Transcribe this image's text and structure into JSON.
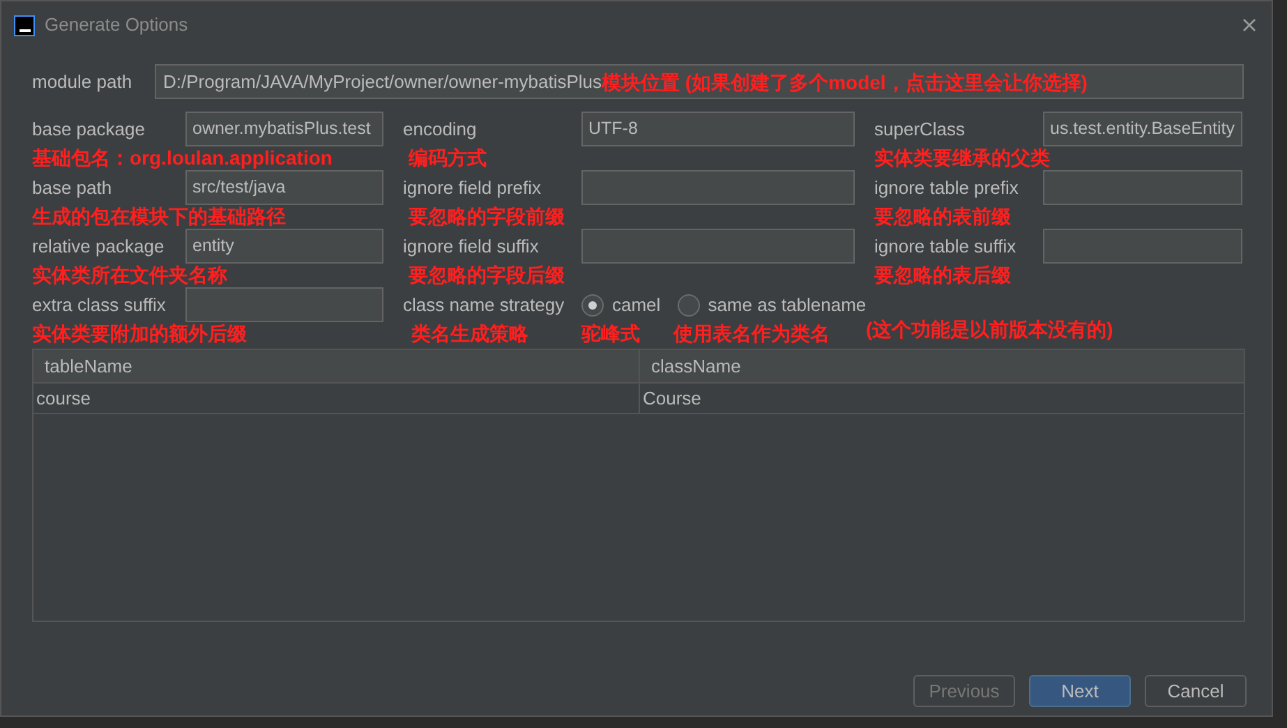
{
  "window": {
    "title": "Generate Options"
  },
  "module_path": {
    "label": "module path",
    "value": "D:/Program/JAVA/MyProject/owner/owner-mybatisPlus",
    "annotation": "模块位置 (如果创建了多个model，点击这里会让你选择)"
  },
  "rows": [
    [
      {
        "kind": "field",
        "label": "base package",
        "value": "owner.mybatisPlus.test",
        "annotation": "基础包名：org.loulan.application"
      },
      {
        "kind": "field",
        "label": "encoding",
        "value": "UTF-8",
        "annotation": "编码方式"
      },
      {
        "kind": "field",
        "label": "superClass",
        "value": "us.test.entity.BaseEntity",
        "annotation": "实体类要继承的父类"
      }
    ],
    [
      {
        "kind": "field",
        "label": "base path",
        "value": "src/test/java",
        "annotation": "生成的包在模块下的基础路径"
      },
      {
        "kind": "field",
        "label": "ignore field prefix",
        "annotation": "要忽略的字段前缀"
      },
      {
        "kind": "field",
        "label": "ignore table prefix",
        "annotation": "要忽略的表前缀"
      }
    ],
    [
      {
        "kind": "field",
        "label": "relative package",
        "value": "entity",
        "annotation": "实体类所在文件夹名称"
      },
      {
        "kind": "field",
        "label": "ignore field suffix",
        "annotation": "要忽略的字段后缀"
      },
      {
        "kind": "field",
        "label": "ignore table suffix",
        "annotation": "要忽略的表后缀"
      }
    ],
    [
      {
        "kind": "field",
        "label": "extra class suffix",
        "annotation": "实体类要附加的额外后缀"
      },
      {
        "kind": "radio_group",
        "label": "class name strategy",
        "annotation": "类名生成策略",
        "note": "(这个功能是以前版本没有的)",
        "options": [
          {
            "label": "camel",
            "selected": true,
            "annotation": "驼峰式"
          },
          {
            "label": "same as tablename",
            "selected": false,
            "annotation": "使用表名作为类名"
          }
        ]
      }
    ]
  ],
  "table": {
    "columns": [
      "tableName",
      "className"
    ],
    "rows": [
      [
        "course",
        "Course"
      ]
    ]
  },
  "buttons": [
    {
      "label": "Previous",
      "disabled": true,
      "primary": false
    },
    {
      "label": "Next",
      "disabled": false,
      "primary": true
    },
    {
      "label": "Cancel",
      "disabled": false,
      "primary": false
    }
  ]
}
